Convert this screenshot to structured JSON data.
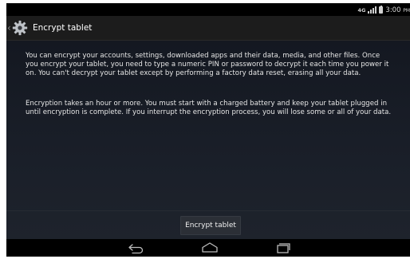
{
  "status_bar": {
    "network_badge": "4G",
    "clock": "3:00",
    "clock_suffix": "PM"
  },
  "action_bar": {
    "title": "Encrypt tablet",
    "icon": "settings-gear-icon"
  },
  "content": {
    "paragraph_1": "You can encrypt your accounts, settings, downloaded apps and their data, media, and other files. Once you encrypt your tablet, you need to type a numeric PIN or password to decrypt it each time you power it on. You can't decrypt your tablet except by performing a factory data reset, erasing all your data.",
    "paragraph_2": "Encryption takes an hour or more. You must start with a charged battery and keep your tablet plugged in until encryption is complete. If you interrupt the encryption process, you will lose some or all of your data.",
    "button_label": "Encrypt tablet"
  },
  "nav_bar": {
    "icons": [
      "back-icon",
      "home-icon",
      "recents-icon"
    ]
  },
  "colors": {
    "action_bar": "#1c1c1c",
    "content_background": "#161b24",
    "text": "#e6e6e6",
    "button": "#2b2f36"
  }
}
